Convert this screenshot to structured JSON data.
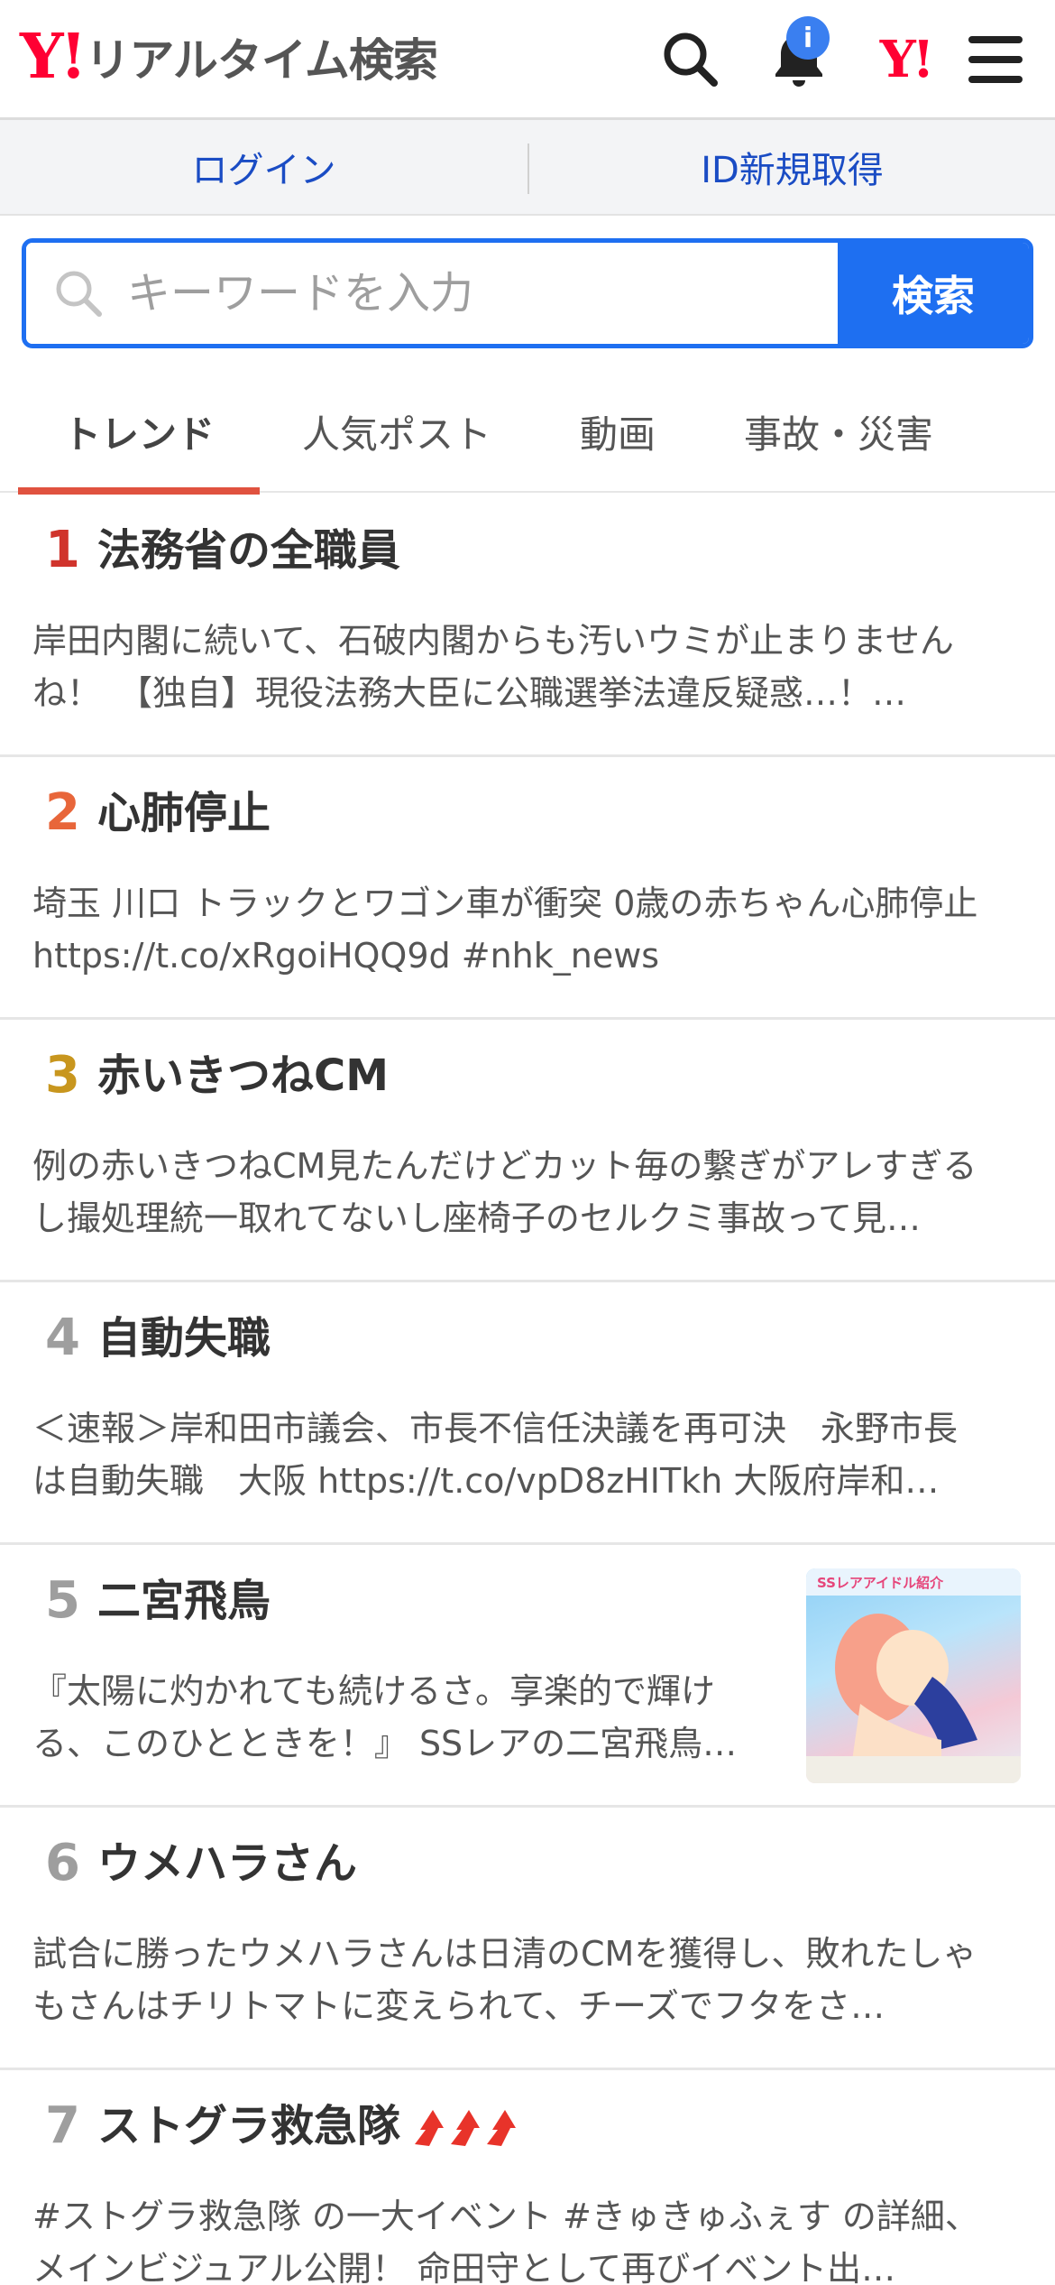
{
  "header": {
    "logo_mark": "Y!",
    "logo_text": "リアルタイム検索",
    "notification_badge": "i",
    "yahoo_mark": "Y!"
  },
  "account": {
    "login": "ログイン",
    "signup": "ID新規取得"
  },
  "search": {
    "placeholder": "キーワードを入力",
    "button": "検索"
  },
  "tabs": [
    "トレンド",
    "人気ポスト",
    "動画",
    "事故・災害"
  ],
  "trends": [
    {
      "rank": "1",
      "rank_color": "#d0342c",
      "title": "法務省の全職員",
      "desc": "岸田内閣に続いて、石破内閣からも汚いウミが止まりませんね！　【独自】現役法務大臣に公職選挙法違反疑惑…！…"
    },
    {
      "rank": "2",
      "rank_color": "#e8663a",
      "title": "心肺停止",
      "desc": "埼玉 川口 トラックとワゴン車が衝突 0歳の赤ちゃん心肺停止 https://t.co/xRgoiHQQ9d #nhk_news"
    },
    {
      "rank": "3",
      "rank_color": "#c8961e",
      "title": "赤いきつねCM",
      "desc": "例の赤いきつねCM見たんだけどカット毎の繋ぎがアレすぎるし撮処理統一取れてないし座椅子のセルクミ事故って見…"
    },
    {
      "rank": "4",
      "rank_color": "#9e9e9e",
      "title": "自動失職",
      "desc": "＜速報＞岸和田市議会、市長不信任決議を再可決　永野市長は自動失職　大阪 https://t.co/vpD8zHITkh 大阪府岸和…"
    },
    {
      "rank": "5",
      "rank_color": "#9e9e9e",
      "title": "二宮飛鳥",
      "desc": "『太陽に灼かれても続けるさ。享楽的で輝ける、このひとときを！』 SSレアの二宮飛鳥…",
      "thumb_text": "SSレアアイドル紹介"
    },
    {
      "rank": "6",
      "rank_color": "#9e9e9e",
      "title": "ウメハラさん",
      "desc": "試合に勝ったウメハラさんは日清のCMを獲得し、敗れたしゃもさんはチリトマトに変えられて、チーズでフタをさ…"
    },
    {
      "rank": "7",
      "rank_color": "#9e9e9e",
      "title": "ストグラ救急隊",
      "desc": "#ストグラ救急隊 の一大イベント #きゅきゅふぇす の詳細、メインビジュアル公開！ 命田守として再びイベント出…"
    }
  ]
}
